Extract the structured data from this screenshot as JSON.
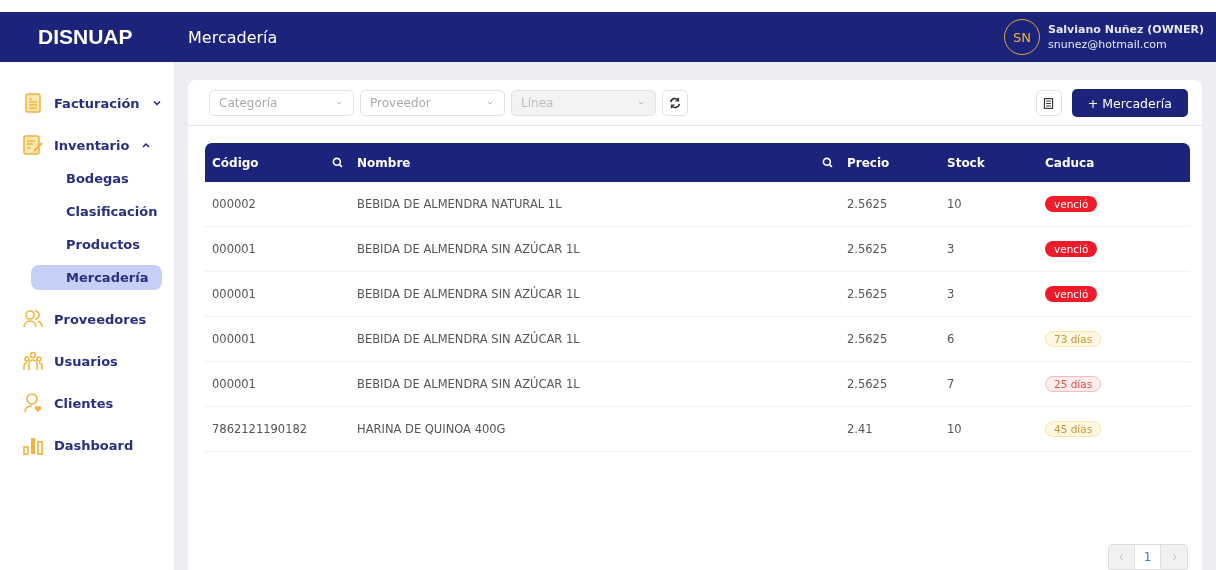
{
  "header": {
    "logo": "DISNUAP",
    "page_title": "Mercadería",
    "user": {
      "initials": "SN",
      "name": "Salviano Nuñez (OWNER)",
      "email": "snunez@hotmail.com"
    }
  },
  "sidebar": {
    "items": [
      {
        "label": "Facturación",
        "expanded": false
      },
      {
        "label": "Inventario",
        "expanded": true,
        "children": [
          {
            "label": "Bodegas",
            "selected": false
          },
          {
            "label": "Clasificación",
            "selected": false
          },
          {
            "label": "Productos",
            "selected": false
          },
          {
            "label": "Mercadería",
            "selected": true
          }
        ]
      },
      {
        "label": "Proveedores"
      },
      {
        "label": "Usuarios"
      },
      {
        "label": "Clientes"
      },
      {
        "label": "Dashboard"
      }
    ]
  },
  "filters": [
    {
      "placeholder": "Categoría",
      "disabled": false
    },
    {
      "placeholder": "Proveedor",
      "disabled": false
    },
    {
      "placeholder": "Línea",
      "disabled": true
    }
  ],
  "add_button": "+ Mercadería",
  "table": {
    "columns": [
      {
        "label": "Código",
        "searchable": true
      },
      {
        "label": "Nombre",
        "searchable": true
      },
      {
        "label": "Precio",
        "searchable": false
      },
      {
        "label": "Stock",
        "searchable": false
      },
      {
        "label": "Caduca",
        "searchable": false
      }
    ],
    "rows": [
      {
        "code": "000002",
        "name": "BEBIDA DE ALMENDRA NATURAL 1L",
        "price": "2.5625",
        "stock": "10",
        "expiry": {
          "text": "venció",
          "kind": "expired"
        }
      },
      {
        "code": "000001",
        "name": "BEBIDA DE ALMENDRA SIN AZÚCAR 1L",
        "price": "2.5625",
        "stock": "3",
        "expiry": {
          "text": "venció",
          "kind": "expired"
        }
      },
      {
        "code": "000001",
        "name": "BEBIDA DE ALMENDRA SIN AZÚCAR 1L",
        "price": "2.5625",
        "stock": "3",
        "expiry": {
          "text": "venció",
          "kind": "expired"
        }
      },
      {
        "code": "000001",
        "name": "BEBIDA DE ALMENDRA SIN AZÚCAR 1L",
        "price": "2.5625",
        "stock": "6",
        "expiry": {
          "text": "73 días",
          "kind": "warning"
        }
      },
      {
        "code": "000001",
        "name": "BEBIDA DE ALMENDRA SIN AZÚCAR 1L",
        "price": "2.5625",
        "stock": "7",
        "expiry": {
          "text": "25 días",
          "kind": "danger"
        }
      },
      {
        "code": "7862121190182",
        "name": "HARINA DE QUINOA 400G",
        "price": "2.41",
        "stock": "10",
        "expiry": {
          "text": "45 días",
          "kind": "warning"
        }
      }
    ]
  },
  "pagination": {
    "pages": [
      {
        "label": "1",
        "selected": true
      }
    ]
  }
}
